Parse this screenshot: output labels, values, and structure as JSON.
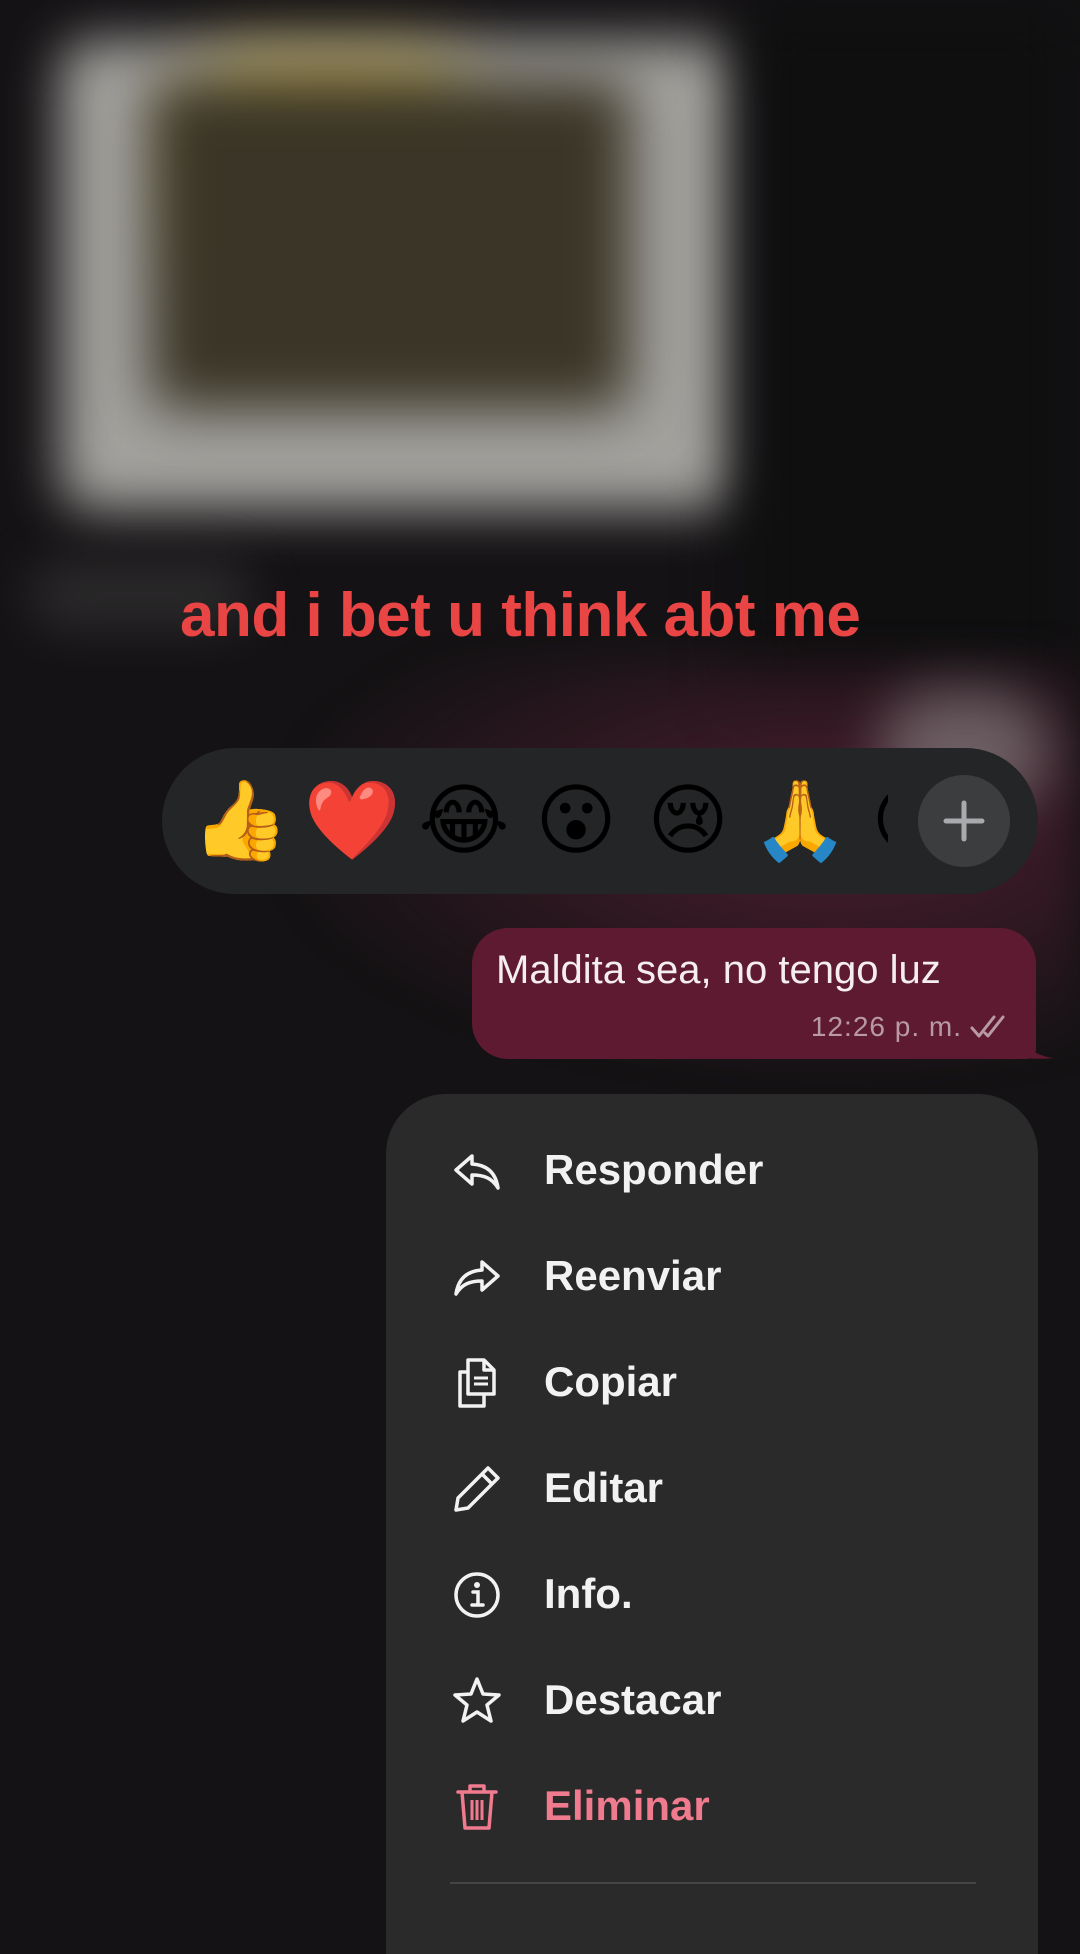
{
  "overlay_caption": "and i bet u think abt me",
  "reactions": {
    "emojis": [
      {
        "glyph": "👍",
        "name": "thumbs-up"
      },
      {
        "glyph": "❤️",
        "name": "red-heart"
      },
      {
        "glyph": "😂",
        "name": "tears-of-joy"
      },
      {
        "glyph": "😮",
        "name": "open-mouth"
      },
      {
        "glyph": "😢",
        "name": "crying-face"
      },
      {
        "glyph": "🙏",
        "name": "folded-hands"
      },
      {
        "glyph": "😘",
        "name": "partially-visible-face"
      }
    ],
    "add_icon": "plus-icon"
  },
  "message": {
    "text": "Maldita sea, no tengo luz",
    "time": "12:26 p. m.",
    "status_icon": "double-check-icon"
  },
  "menu": {
    "items": [
      {
        "label": "Responder",
        "icon": "reply-icon"
      },
      {
        "label": "Reenviar",
        "icon": "forward-icon"
      },
      {
        "label": "Copiar",
        "icon": "copy-icon"
      },
      {
        "label": "Editar",
        "icon": "pencil-icon"
      },
      {
        "label": "Info.",
        "icon": "info-icon"
      },
      {
        "label": "Destacar",
        "icon": "star-icon"
      },
      {
        "label": "Eliminar",
        "icon": "trash-icon"
      }
    ]
  },
  "colors": {
    "caption": "#ea4545",
    "bubble": "#5e1a30",
    "menu_bg": "#2a2a2b",
    "danger": "#f07a8e"
  }
}
